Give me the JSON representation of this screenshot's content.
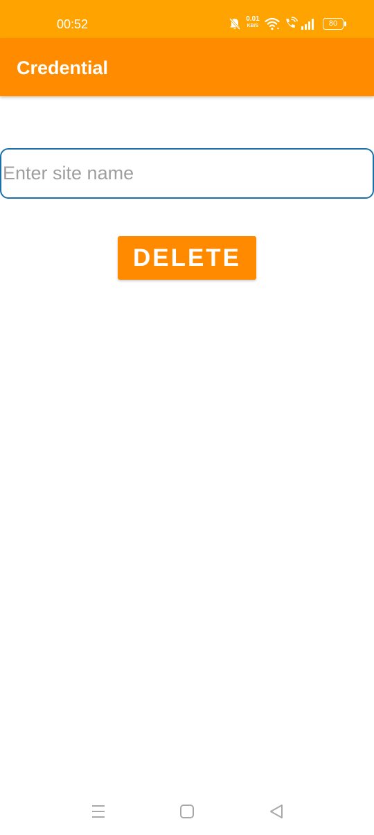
{
  "status_bar": {
    "time": "00:52",
    "network_speed": "0.01",
    "network_speed_unit": "KB/S",
    "battery": "80",
    "icons": [
      "mute-icon",
      "wifi-icon",
      "wifi-calling-icon",
      "signal-icon",
      "battery-icon"
    ]
  },
  "app_bar": {
    "title": "Credential"
  },
  "form": {
    "site_name": {
      "value": "",
      "placeholder": "Enter site name"
    },
    "delete_label": "DELETE"
  },
  "nav_bar": {
    "icons": [
      "recent-apps-icon",
      "home-icon",
      "back-icon"
    ]
  },
  "colors": {
    "status_bar": "#ffa300",
    "app_bar": "#ff8c00",
    "button": "#ff8a00",
    "input_border": "#1a6fa8"
  }
}
